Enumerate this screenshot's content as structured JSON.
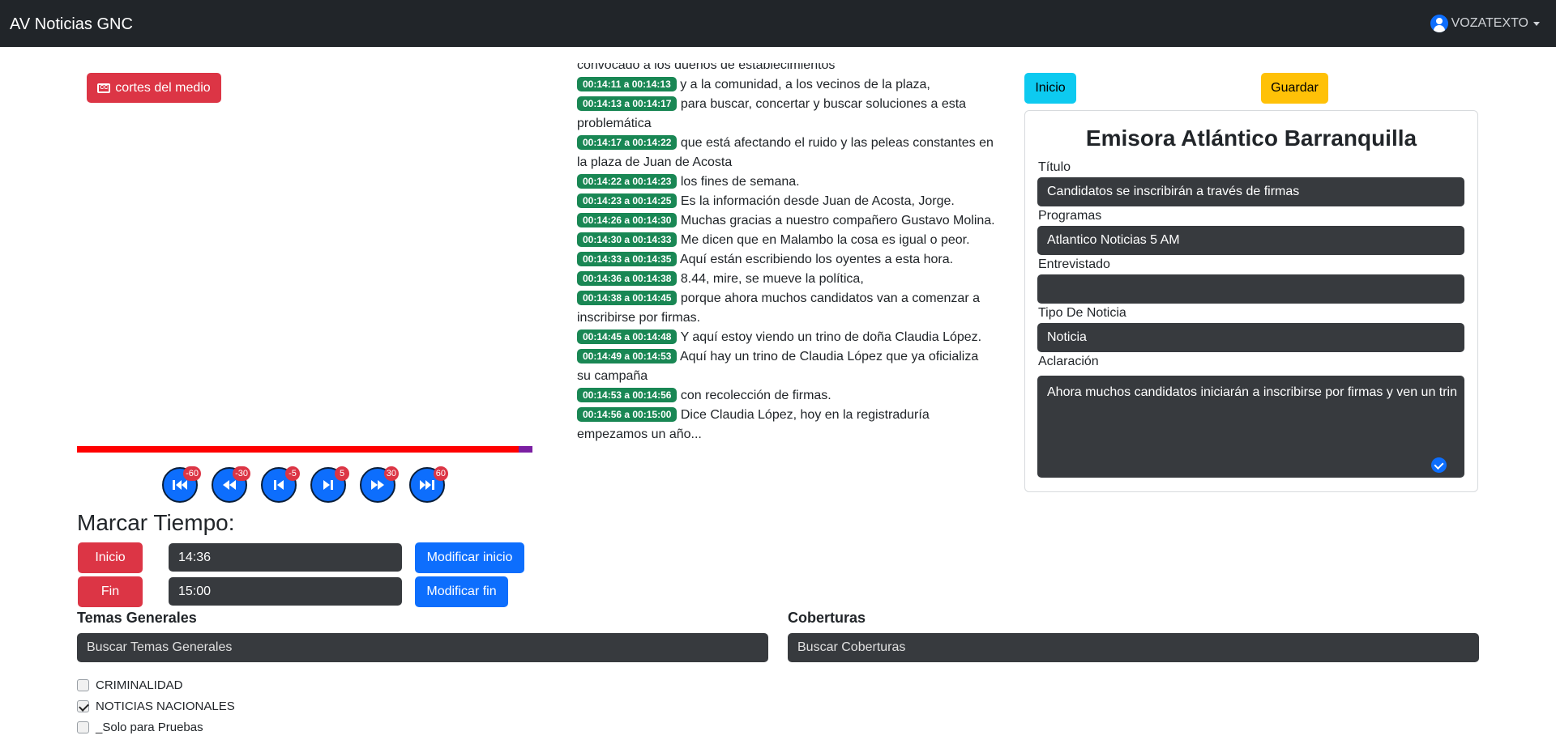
{
  "navbar": {
    "brand": "AV Noticias GNC",
    "user": "VOZATEXTO"
  },
  "player": {
    "cortes_label": "cortes del medio",
    "cc_icon": "CC",
    "progress": 0.97,
    "controls": [
      {
        "icon": "skip-back-60-icon",
        "badge": "-60"
      },
      {
        "icon": "rewind-30-icon",
        "badge": "-30"
      },
      {
        "icon": "step-back-5-icon",
        "badge": "-5"
      },
      {
        "icon": "step-forward-5-icon",
        "badge": "5"
      },
      {
        "icon": "fast-forward-30-icon",
        "badge": "30"
      },
      {
        "icon": "skip-forward-60-icon",
        "badge": "60"
      }
    ]
  },
  "marcar": {
    "title": "Marcar Tiempo:",
    "inicio_label": "Inicio",
    "inicio_value": "14:36",
    "modificar_inicio": "Modificar inicio",
    "fin_label": "Fin",
    "fin_value": "15:00",
    "modificar_fin": "Modificar fin"
  },
  "transcript": {
    "intro": "convocado a los dueños de establecimientos",
    "lines": [
      {
        "time": "00:14:11 a 00:14:13",
        "text": "y a la comunidad, a los vecinos de la plaza,"
      },
      {
        "time": "00:14:13 a 00:14:17",
        "text": "para buscar, concertar y buscar soluciones a esta problemática"
      },
      {
        "time": "00:14:17 a 00:14:22",
        "text": "que está afectando el ruido y las peleas constantes en la plaza de Juan de Acosta"
      },
      {
        "time": "00:14:22 a 00:14:23",
        "text": "los fines de semana."
      },
      {
        "time": "00:14:23 a 00:14:25",
        "text": "Es la información desde Juan de Acosta, Jorge."
      },
      {
        "time": "00:14:26 a 00:14:30",
        "text": "Muchas gracias a nuestro compañero Gustavo Molina."
      },
      {
        "time": "00:14:30 a 00:14:33",
        "text": "Me dicen que en Malambo la cosa es igual o peor."
      },
      {
        "time": "00:14:33 a 00:14:35",
        "text": "Aquí están escribiendo los oyentes a esta hora."
      },
      {
        "time": "00:14:36 a 00:14:38",
        "text": "8.44, mire, se mueve la política,"
      },
      {
        "time": "00:14:38 a 00:14:45",
        "text": "porque ahora muchos candidatos van a comenzar a inscribirse por firmas."
      },
      {
        "time": "00:14:45 a 00:14:48",
        "text": "Y aquí estoy viendo un trino de doña Claudia López."
      },
      {
        "time": "00:14:49 a 00:14:53",
        "text": "Aquí hay un trino de Claudia López que ya oficializa su campaña"
      },
      {
        "time": "00:14:53 a 00:14:56",
        "text": "con recolección de firmas."
      },
      {
        "time": "00:14:56 a 00:15:00",
        "text": "Dice Claudia López, hoy en la registraduría empezamos un año..."
      }
    ]
  },
  "form": {
    "inicio_button": "Inicio",
    "guardar_button": "Guardar",
    "station": "Emisora Atlántico Barranquilla",
    "titulo_label": "Título",
    "titulo_value": "Candidatos se inscribirán a través de firmas",
    "programas_label": "Programas",
    "programas_value": "Atlantico Noticias 5 AM",
    "entrevistado_label": "Entrevistado",
    "entrevistado_value": "",
    "tipo_label": "Tipo De Noticia",
    "tipo_value": "Noticia",
    "aclaracion_label": "Aclaración",
    "aclaracion_value": "Ahora muchos candidatos iniciarán a inscribirse por firmas y ven un trin"
  },
  "temas": {
    "title": "Temas Generales",
    "placeholder": "Buscar Temas Generales",
    "items": [
      {
        "label": "CRIMINALIDAD",
        "checked": false
      },
      {
        "label": "NOTICIAS NACIONALES",
        "checked": true
      },
      {
        "label": "_Solo para Pruebas",
        "checked": false
      }
    ]
  },
  "coberturas": {
    "title": "Coberturas",
    "placeholder": "Buscar Coberturas"
  }
}
